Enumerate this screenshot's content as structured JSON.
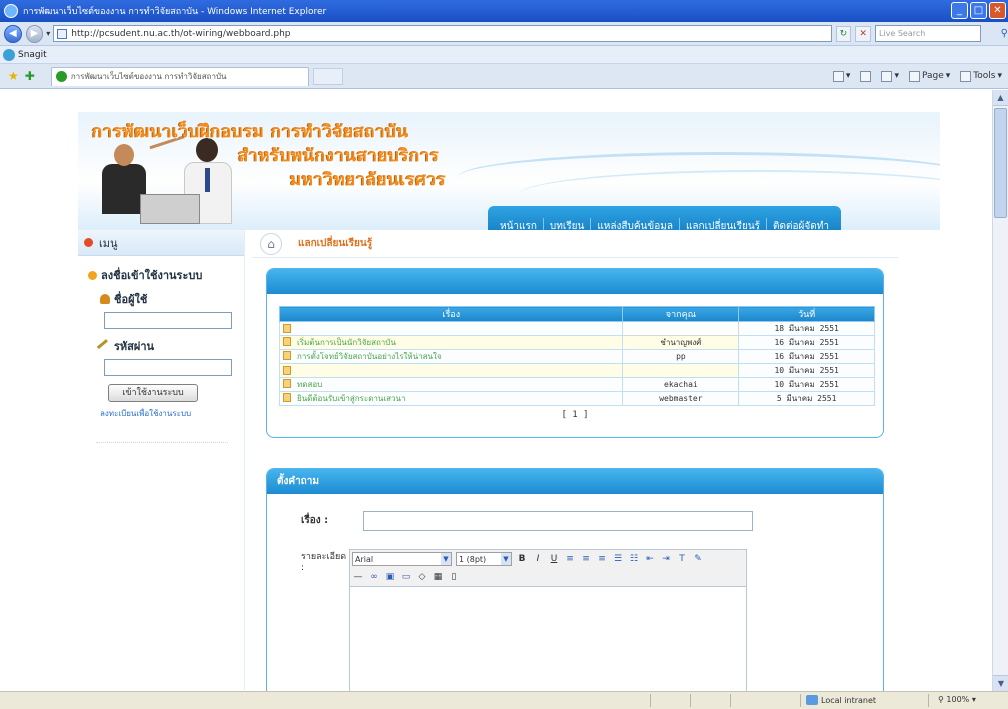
{
  "browser": {
    "window_title": "การพัฒนาเว็บไซต์ของงาน การทำวิจัยสถาบัน - Windows Internet Explorer",
    "url": "http://pcsudent.nu.ac.th/ot-wiring/webboard.php",
    "live_search_placeholder": "Live Search",
    "links_label": "Snagit",
    "tab_title": "การพัฒนาเว็บไซต์ของงาน การทำวิจัยสถาบัน",
    "page_menu": "Page",
    "tools_menu": "Tools",
    "status_zone": "Local intranet",
    "status_zoom": "100%"
  },
  "banner": {
    "line1": "การพัฒนาเว็บฝึกอบรม การทำวิจัยสถาบัน",
    "line2": "สำหรับพนักงานสายบริการ",
    "line3": "มหาวิทยาลัยนเรศวร"
  },
  "mainnav": [
    "หน้าแรก",
    "บทเรียน",
    "แหล่งสืบค้นข้อมูล",
    "แลกเปลี่ยนเรียนรู้",
    "ติดต่อผู้จัดทำ"
  ],
  "sidebar": {
    "menu_title": "เมนู",
    "login_title": "ลงชื่อเข้าใช้งานระบบ",
    "username_label": "ชื่อผู้ใช้",
    "password_label": "รหัสผ่าน",
    "login_button": "เข้าใช้งานระบบ",
    "register_link": "ลงทะเบียนเพื่อใช้งานระบบ"
  },
  "content": {
    "breadcrumb": "แลกเปลี่ยนเรียนรู้",
    "board": {
      "headers": [
        "เรื่อง",
        "จากคุณ",
        "วันที่"
      ],
      "rows": [
        {
          "title": "",
          "author": "",
          "date": "18 มีนาคม 2551",
          "highlight": false
        },
        {
          "title": "เริ่มต้นการเป็นนักวิจัยสถาบัน",
          "author": "ชำนาญพงศ์",
          "date": "16 มีนาคม 2551",
          "highlight": true
        },
        {
          "title": "การตั้งโจทย์วิจัยสถาบันอย่างไรให้น่าสนใจ",
          "author": "pp",
          "date": "16 มีนาคม 2551",
          "highlight": false
        },
        {
          "title": "",
          "author": "",
          "date": "10 มีนาคม 2551",
          "highlight": true
        },
        {
          "title": "ทดสอบ",
          "author": "ekachai",
          "date": "10 มีนาคม 2551",
          "highlight": false
        },
        {
          "title": "ยินดีต้อนรับเข้าสู่กระดานเสวนา",
          "author": "webmaster",
          "date": "5 มีนาคม 2551",
          "highlight": false
        }
      ],
      "pager": "[ 1 ]"
    },
    "form": {
      "panel_title": "ตั้งคำถาม",
      "subject_label": "เรื่อง :",
      "detail_label": "รายละเอียด :",
      "font_name": "Arial",
      "font_size": "1 (8pt)"
    }
  }
}
